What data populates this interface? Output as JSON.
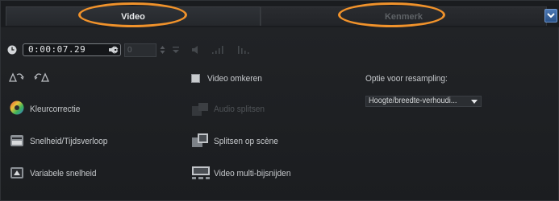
{
  "tabs": [
    {
      "label": "Video",
      "active": true
    },
    {
      "label": "Kenmerk",
      "active": false
    }
  ],
  "toolbar": {
    "timecode": "0:00:07.29",
    "volume": "0"
  },
  "left_column": {
    "kleurcorrectie": "Kleurcorrectie",
    "snelheid": "Snelheid/Tijdsverloop",
    "variabele": "Variabele snelheid"
  },
  "middle_column": {
    "video_omkeren": "Video omkeren",
    "audio_splitsen": "Audio splitsen",
    "splitsen_scene": "Splitsen op scène",
    "multi_bijsnijden": "Video multi-bijsnijden"
  },
  "resampling": {
    "label": "Optie voor resampling:",
    "selected": "Hoogte/breedte-verhoudi..."
  },
  "colors": {
    "highlight_ring": "#f0922b",
    "accent_button": "#3a66a3",
    "background": "#1d1f22"
  }
}
